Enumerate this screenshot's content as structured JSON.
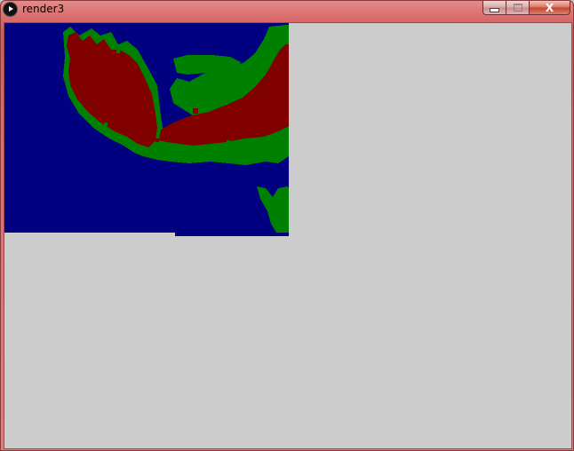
{
  "window": {
    "title": "render3",
    "icon": "processing-play-icon",
    "controls": {
      "minimize_icon": "minimize-icon",
      "maximize_icon": "maximize-icon",
      "close_label": "X"
    }
  },
  "canvas": {
    "background": "#cccccc",
    "palette": {
      "background": "#000080",
      "hand": "#800000",
      "edge": "#008000"
    }
  }
}
